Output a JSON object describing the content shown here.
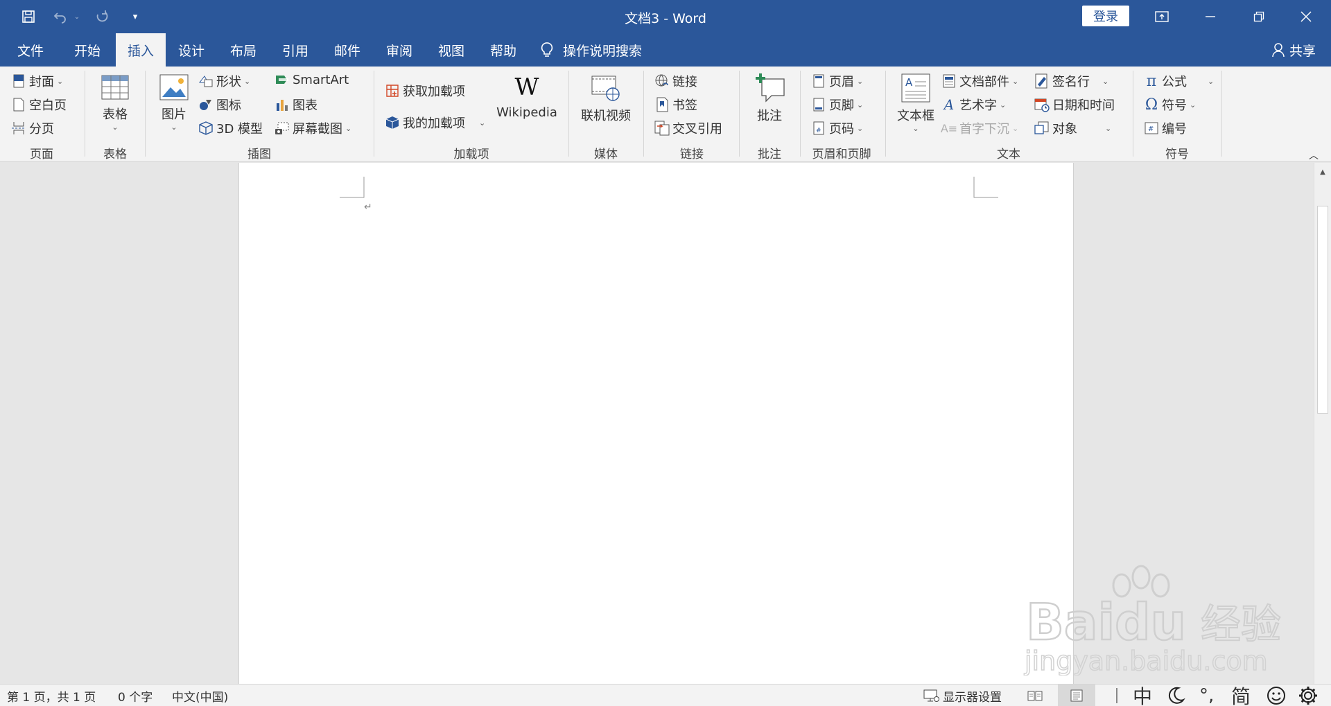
{
  "window": {
    "title": "文档3  -  Word",
    "login_label": "登录",
    "share_label": "共享"
  },
  "tabs": [
    "文件",
    "开始",
    "插入",
    "设计",
    "布局",
    "引用",
    "邮件",
    "审阅",
    "视图",
    "帮助"
  ],
  "active_tab": "插入",
  "tell_me": "操作说明搜索",
  "ribbon": {
    "pages": {
      "cover": "封面",
      "blank": "空白页",
      "break": "分页",
      "group": "页面"
    },
    "tables": {
      "table": "表格",
      "group": "表格"
    },
    "illustrations": {
      "picture": "图片",
      "shapes": "形状",
      "icons": "图标",
      "model3d": "3D 模型",
      "smartart": "SmartArt",
      "chart": "图表",
      "screenshot": "屏幕截图",
      "group": "插图"
    },
    "addins": {
      "get": "获取加载项",
      "my": "我的加载项",
      "wikipedia": "Wikipedia",
      "group": "加载项"
    },
    "media": {
      "online_video": "联机视频",
      "group": "媒体"
    },
    "links": {
      "link": "链接",
      "bookmark": "书签",
      "crossref": "交叉引用",
      "group": "链接"
    },
    "comments": {
      "comment": "批注",
      "group": "批注"
    },
    "header_footer": {
      "header": "页眉",
      "footer": "页脚",
      "page_number": "页码",
      "group": "页眉和页脚"
    },
    "text": {
      "textbox": "文本框",
      "quickparts": "文档部件",
      "wordart": "艺术字",
      "dropcap": "首字下沉",
      "signature": "签名行",
      "datetime": "日期和时间",
      "object": "对象",
      "group": "文本"
    },
    "symbols": {
      "equation": "公式",
      "symbol": "符号",
      "number": "编号",
      "group": "符号"
    }
  },
  "status": {
    "page": "第 1 页，共 1 页",
    "words": "0 个字",
    "language": "中文(中国)",
    "display": "显示器设置"
  },
  "ime": {
    "mode": "中",
    "punct": "°,",
    "script": "简"
  },
  "watermark": {
    "brand": "Baidu",
    "jingyan": "经验",
    "url": "jingyan.baidu.com"
  },
  "colors": {
    "accent": "#2b579a",
    "ribbon_bg": "#f3f3f3",
    "canvas_bg": "#e6e6e6"
  }
}
